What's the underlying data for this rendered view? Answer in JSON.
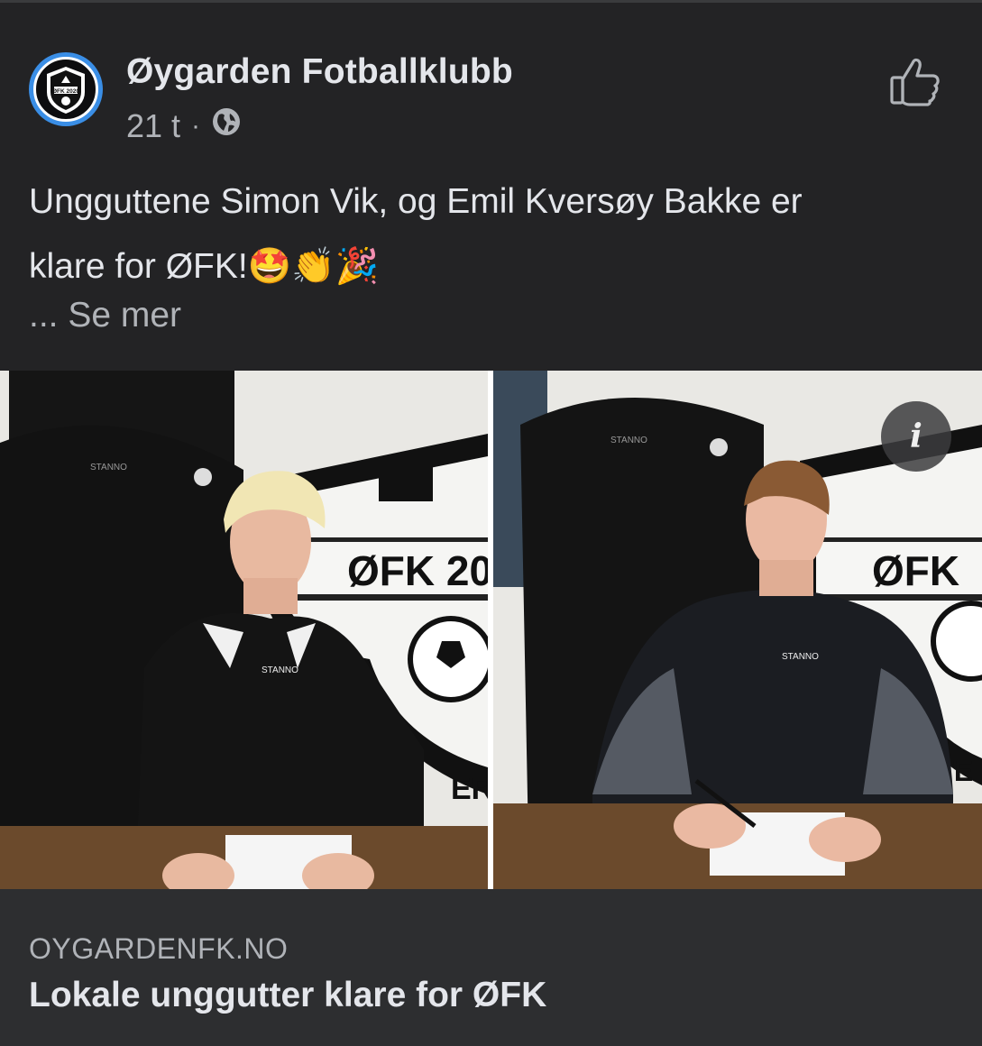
{
  "post": {
    "page_name": "Øygarden Fotballklubb",
    "time": "21 t",
    "separator": "·",
    "privacy_icon": "globe-icon",
    "like_icon": "thumbs-up-icon",
    "text_line1": "Ungguttene Simon Vik, og Emil Kversøy Bakke er",
    "text_line2": "klare for ØFK!🤩👏🎉",
    "see_more": "... Se mer",
    "info_icon": "i"
  },
  "avatar": {
    "logo_text": "ØFK 2020"
  },
  "photos": [
    {
      "logo_text": "ØFK 20",
      "sponsor": "STANNO",
      "tail_text": "ER"
    },
    {
      "logo_text": "ØFK",
      "sponsor": "STANNO",
      "tail_text": "STE"
    }
  ],
  "link_card": {
    "domain": "OYGARDENFK.NO",
    "title": "Lokale unggutter klare for ØFK"
  },
  "colors": {
    "background": "#232325",
    "card": "#2d2e30",
    "avatar_ring": "#3a8ee6",
    "text_primary": "#e4e6eb",
    "text_secondary": "#b0b3b8"
  }
}
